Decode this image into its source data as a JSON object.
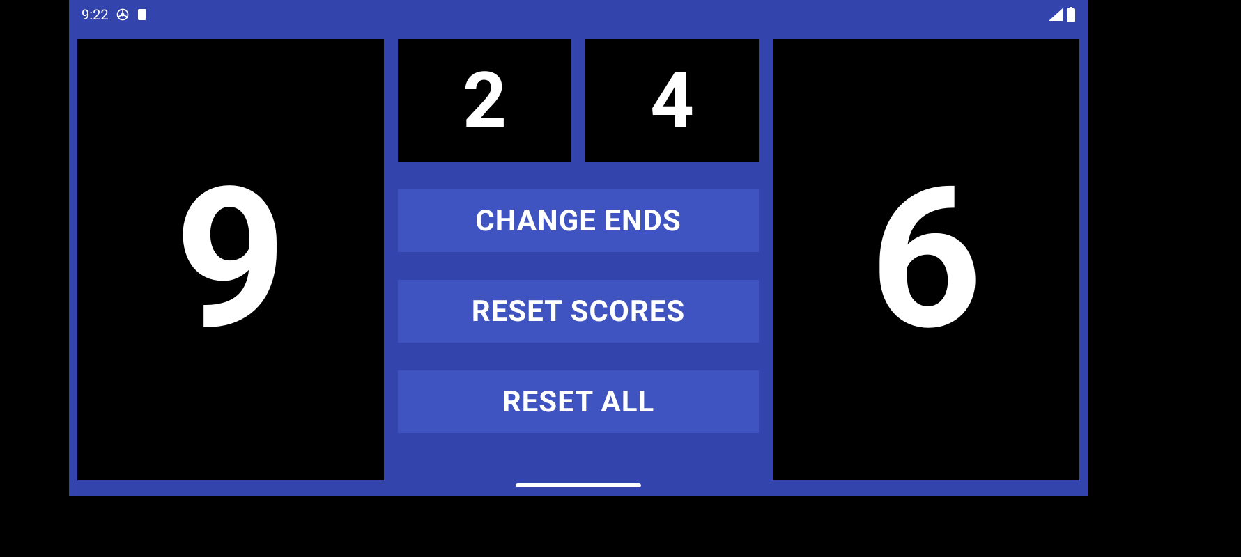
{
  "statusbar": {
    "time": "9:22"
  },
  "scores": {
    "left_main": "9",
    "right_main": "6",
    "left_small": "2",
    "right_small": "4"
  },
  "buttons": {
    "change_ends": "CHANGE ENDS",
    "reset_scores": "RESET SCORES",
    "reset_all": "RESET ALL"
  }
}
